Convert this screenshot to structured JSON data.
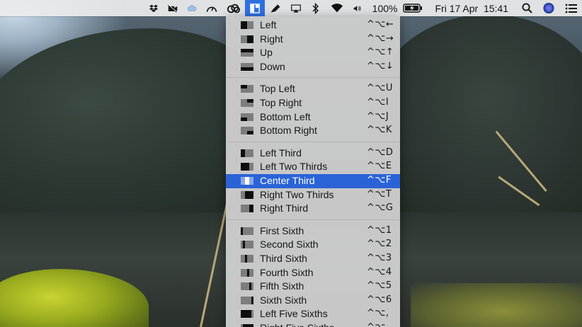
{
  "menubar": {
    "icons": [
      "dropbox-icon",
      "camera-off-icon",
      "cloud-icon",
      "speedometer-icon",
      "creative-cloud-icon",
      "window-layout-icon",
      "pen-icon",
      "airplay-icon",
      "bluetooth-icon",
      "wifi-icon",
      "volume-icon"
    ],
    "battery": "100%",
    "datetime": "Fri 17 Apr  15:41",
    "right_icons": [
      "search-icon",
      "siri-icon",
      "list-icon"
    ]
  },
  "menu": {
    "groups": [
      {
        "items": [
          {
            "label": "Left",
            "shortcut": "^⌥←",
            "icon": "half-left-icon"
          },
          {
            "label": "Right",
            "shortcut": "^⌥→",
            "icon": "half-right-icon"
          },
          {
            "label": "Up",
            "shortcut": "^⌥↑",
            "icon": "half-top-icon"
          },
          {
            "label": "Down",
            "shortcut": "^⌥↓",
            "icon": "half-bottom-icon"
          }
        ]
      },
      {
        "items": [
          {
            "label": "Top Left",
            "shortcut": "^⌥U",
            "icon": "quarter-top-left-icon"
          },
          {
            "label": "Top Right",
            "shortcut": "^⌥I",
            "icon": "quarter-top-right-icon"
          },
          {
            "label": "Bottom Left",
            "shortcut": "^⌥J",
            "icon": "quarter-bottom-left-icon"
          },
          {
            "label": "Bottom Right",
            "shortcut": "^⌥K",
            "icon": "quarter-bottom-right-icon"
          }
        ]
      },
      {
        "items": [
          {
            "label": "Left Third",
            "shortcut": "^⌥D",
            "icon": "third-left-icon"
          },
          {
            "label": "Left Two Thirds",
            "shortcut": "^⌥E",
            "icon": "two-thirds-left-icon"
          },
          {
            "label": "Center Third",
            "shortcut": "^⌥F",
            "icon": "third-center-icon",
            "selected": true
          },
          {
            "label": "Right Two Thirds",
            "shortcut": "^⌥T",
            "icon": "two-thirds-right-icon"
          },
          {
            "label": "Right Third",
            "shortcut": "^⌥G",
            "icon": "third-right-icon"
          }
        ]
      },
      {
        "items": [
          {
            "label": "First Sixth",
            "shortcut": "^⌥1",
            "icon": "sixth-1-icon"
          },
          {
            "label": "Second Sixth",
            "shortcut": "^⌥2",
            "icon": "sixth-2-icon"
          },
          {
            "label": "Third Sixth",
            "shortcut": "^⌥3",
            "icon": "sixth-3-icon"
          },
          {
            "label": "Fourth Sixth",
            "shortcut": "^⌥4",
            "icon": "sixth-4-icon"
          },
          {
            "label": "Fifth Sixth",
            "shortcut": "^⌥5",
            "icon": "sixth-5-icon"
          },
          {
            "label": "Sixth Sixth",
            "shortcut": "^⌥6",
            "icon": "sixth-6-icon"
          },
          {
            "label": "Left Five Sixths",
            "shortcut": "^⌥,",
            "icon": "five-sixths-left-icon"
          },
          {
            "label": "Right Five Sixths",
            "shortcut": "^⌥.",
            "icon": "five-sixths-right-icon"
          }
        ]
      }
    ]
  },
  "colors": {
    "selection": "#2a63d8",
    "menu_background": "#cccccc",
    "active_status_item": "#2f6fe0"
  }
}
